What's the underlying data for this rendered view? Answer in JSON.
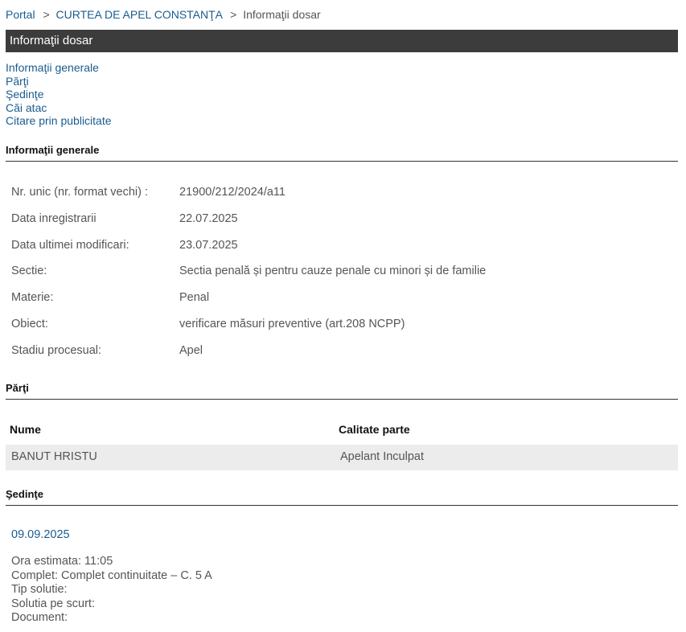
{
  "breadcrumb": {
    "portal": "Portal",
    "court": "CURTEA DE APEL CONSTANŢA",
    "current": "Informaţii dosar",
    "separator": ">"
  },
  "header": {
    "title": "Informaţii dosar"
  },
  "nav": [
    "Informaţii generale",
    "Părţi",
    "Şedinţe",
    "Căi atac",
    "Citare prin publicitate"
  ],
  "general": {
    "title": "Informaţii generale",
    "rows": [
      {
        "label": "Nr. unic (nr. format vechi) :",
        "value": "21900/212/2024/a11"
      },
      {
        "label": "Data inregistrarii",
        "value": "22.07.2025"
      },
      {
        "label": "Data ultimei modificari:",
        "value": "23.07.2025"
      },
      {
        "label": "Sectie:",
        "value": "Sectia penală și pentru cauze penale cu minori și de familie"
      },
      {
        "label": "Materie:",
        "value": "Penal"
      },
      {
        "label": "Obiect:",
        "value": "verificare măsuri preventive (art.208 NCPP)"
      },
      {
        "label": "Stadiu procesual:",
        "value": "Apel"
      }
    ]
  },
  "parties": {
    "title": "Părţi",
    "columns": [
      "Nume",
      "Calitate parte"
    ],
    "rows": [
      {
        "name": "BANUT HRISTU",
        "role": "Apelant Inculpat"
      }
    ]
  },
  "hearings": {
    "title": "Şedinţe",
    "items": [
      {
        "date": "09.09.2025",
        "details": [
          "Ora estimata: 11:05",
          "Complet: Complet continuitate – C. 5 A",
          "Tip solutie:",
          "Solutia pe scurt:",
          "Document:"
        ]
      }
    ]
  },
  "colors": {
    "link": "#1a5c8f",
    "header_bg": "#3c3c3c",
    "row_bg": "#ececec"
  }
}
